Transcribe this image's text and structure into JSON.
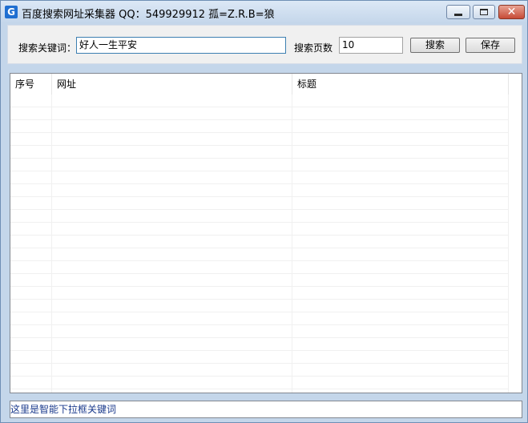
{
  "window": {
    "title": "百度搜索网址采集器 QQ：549929912 孤=Z.R.B=狼",
    "icon_letter": "G",
    "close_glyph": "✕"
  },
  "search": {
    "keyword_label": "搜索关键词：",
    "keyword_value": "好人一生平安",
    "pages_label": "搜索页数",
    "pages_value": "10",
    "search_button": "搜索",
    "save_button": "保存"
  },
  "table": {
    "columns": [
      "序号",
      "网址",
      "标题"
    ],
    "rows": []
  },
  "status": {
    "hint": "这里是智能下拉框关键词"
  },
  "colors": {
    "accent": "#1f6fd1",
    "close_button": "#c74b36",
    "status_text": "#1a3a8c"
  }
}
